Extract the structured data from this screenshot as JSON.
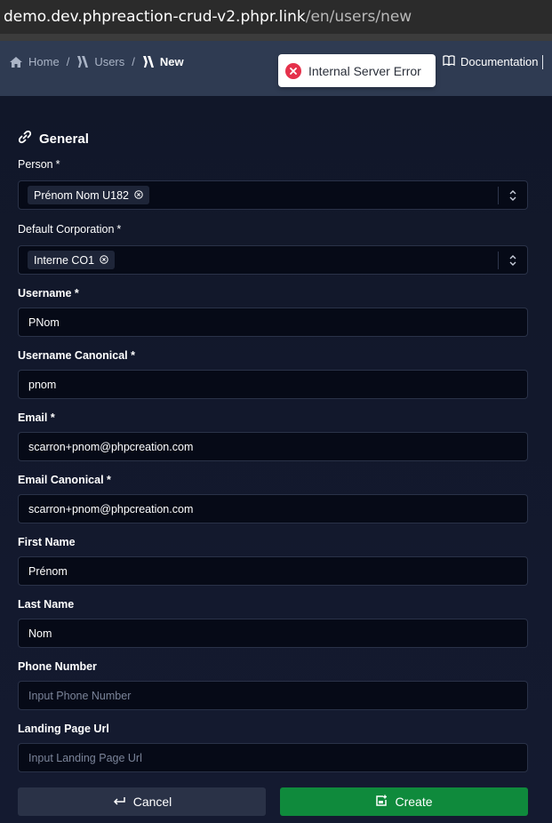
{
  "browser": {
    "url_host": "demo.dev.phpreaction-crud-v2.phpr.link",
    "url_path": "/en/users/new"
  },
  "breadcrumb": {
    "items": [
      {
        "label": "Home",
        "icon": "home-icon"
      },
      {
        "label": "Users",
        "icon": "users-icon"
      },
      {
        "label": "New",
        "icon": "user-icon"
      }
    ],
    "separator": "/"
  },
  "toast": {
    "message": "Internal Server Error",
    "icon": "error-icon",
    "color": "#e5314b"
  },
  "header": {
    "documentation_label": "Documentation",
    "documentation_icon": "book-icon"
  },
  "form": {
    "section_title": "General",
    "section_icon": "link-icon",
    "required_mark": "*",
    "person": {
      "label": "Person",
      "value": "Prénom Nom U182"
    },
    "default_corporation": {
      "label": "Default Corporation",
      "value": "Interne CO1"
    },
    "username": {
      "label": "Username *",
      "value": "PNom"
    },
    "username_canonical": {
      "label": "Username Canonical *",
      "value": "pnom"
    },
    "email": {
      "label": "Email *",
      "value": "scarron+pnom@phpcreation.com"
    },
    "email_canonical": {
      "label": "Email Canonical *",
      "value": "scarron+pnom@phpcreation.com"
    },
    "first_name": {
      "label": "First Name",
      "value": "Prénom"
    },
    "last_name": {
      "label": "Last Name",
      "value": "Nom"
    },
    "phone_number": {
      "label": "Phone Number",
      "placeholder": "Input Phone Number"
    },
    "landing_page_url": {
      "label": "Landing Page Url",
      "placeholder": "Input Landing Page Url"
    }
  },
  "actions": {
    "cancel_label": "Cancel",
    "create_label": "Create",
    "create_color": "#0f8a3c"
  }
}
